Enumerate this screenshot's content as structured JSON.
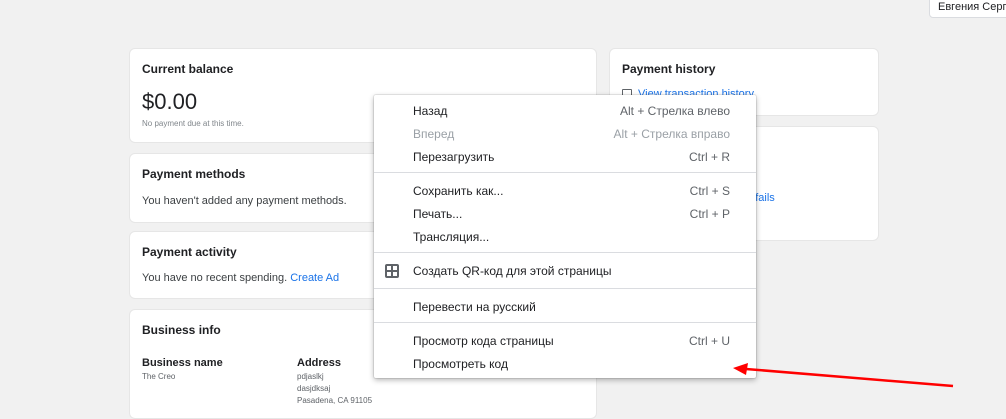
{
  "account": {
    "name": "Евгения Серге"
  },
  "balance_card": {
    "title": "Current balance",
    "amount": "$0.00",
    "note": "No payment due at this time."
  },
  "payment_methods_card": {
    "title": "Payment methods",
    "text": "You haven't added any payment methods."
  },
  "payment_activity_card": {
    "title": "Payment activity",
    "text": "You have no recent spending.",
    "link": "Create Ad"
  },
  "business_info_card": {
    "title": "Business info",
    "business_name_label": "Business name",
    "business_name_value": "The Creo",
    "address_label": "Address",
    "address_lines": [
      "pdjaslkj",
      "dasjdksaj",
      "Pasadena, CA 91105"
    ]
  },
  "payment_history_card": {
    "title": "Payment history",
    "link": "View transaction history"
  },
  "notifications_card": {
    "link_partial": "nt fails"
  },
  "context_menu": {
    "items": [
      {
        "label": "Назад",
        "shortcut": "Alt + Стрелка влево",
        "disabled": false
      },
      {
        "label": "Вперед",
        "shortcut": "Alt + Стрелка вправо",
        "disabled": true
      },
      {
        "label": "Перезагрузить",
        "shortcut": "Ctrl + R",
        "disabled": false
      },
      {
        "label": "Сохранить как...",
        "shortcut": "Ctrl + S",
        "disabled": false
      },
      {
        "label": "Печать...",
        "shortcut": "Ctrl + P",
        "disabled": false
      },
      {
        "label": "Трансляция...",
        "shortcut": "",
        "disabled": false
      },
      {
        "label": "Создать QR-код для этой страницы",
        "shortcut": "",
        "disabled": false,
        "icon": "qr-code-icon"
      },
      {
        "label": "Перевести на русский",
        "shortcut": "",
        "disabled": false
      },
      {
        "label": "Просмотр кода страницы",
        "shortcut": "Ctrl + U",
        "disabled": false
      },
      {
        "label": "Просмотреть код",
        "shortcut": "",
        "disabled": false
      }
    ]
  },
  "annotation": {
    "arrow_color": "#ff0000"
  }
}
